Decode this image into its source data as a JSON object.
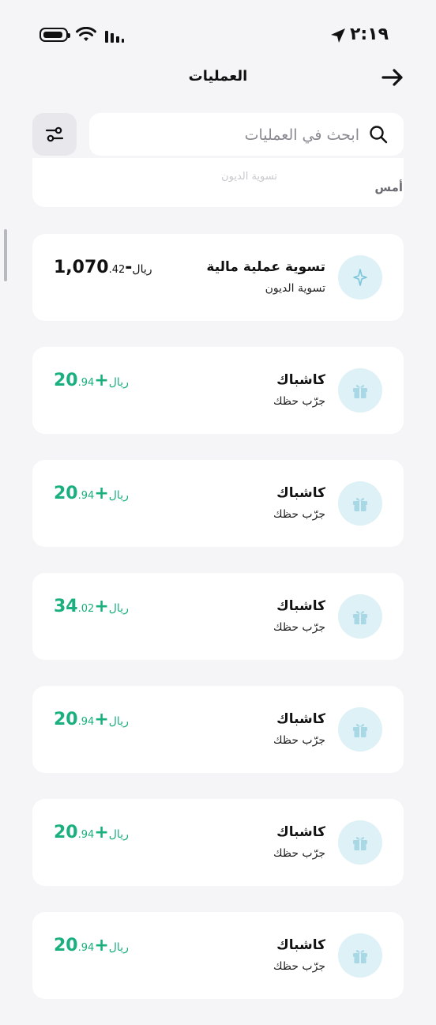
{
  "status_bar": {
    "time": "٢:١٩"
  },
  "header": {
    "title": "العمليات"
  },
  "search": {
    "placeholder": "ابحث في العمليات"
  },
  "section": {
    "label": "أمس"
  },
  "partial_card": {
    "text": "تسوية الديون"
  },
  "transactions": [
    {
      "title": "تسوية عملية مالية",
      "subtitle": "تسوية الديون",
      "amount_main": "-1,070",
      "amount_decimal": ".42",
      "currency": "ريال",
      "icon": "sparkle-icon",
      "color": "#111111"
    },
    {
      "title": "كاشباك",
      "subtitle": "جرّب حظك",
      "amount_main": "+20",
      "amount_decimal": ".94",
      "currency": "ريال",
      "icon": "gift-icon",
      "color": "#1aaf7e"
    },
    {
      "title": "كاشباك",
      "subtitle": "جرّب حظك",
      "amount_main": "+20",
      "amount_decimal": ".94",
      "currency": "ريال",
      "icon": "gift-icon",
      "color": "#1aaf7e"
    },
    {
      "title": "كاشباك",
      "subtitle": "جرّب حظك",
      "amount_main": "+34",
      "amount_decimal": ".02",
      "currency": "ريال",
      "icon": "gift-icon",
      "color": "#1aaf7e"
    },
    {
      "title": "كاشباك",
      "subtitle": "جرّب حظك",
      "amount_main": "+20",
      "amount_decimal": ".94",
      "currency": "ريال",
      "icon": "gift-icon",
      "color": "#1aaf7e"
    },
    {
      "title": "كاشباك",
      "subtitle": "جرّب حظك",
      "amount_main": "+20",
      "amount_decimal": ".94",
      "currency": "ريال",
      "icon": "gift-icon",
      "color": "#1aaf7e"
    },
    {
      "title": "كاشباك",
      "subtitle": "جرّب حظك",
      "amount_main": "+20",
      "amount_decimal": ".94",
      "currency": "ريال",
      "icon": "gift-icon",
      "color": "#1aaf7e"
    }
  ],
  "colors": {
    "positive": "#1aaf7e",
    "icon_bg": "#ddf1f6",
    "background": "#f5f5f8"
  }
}
